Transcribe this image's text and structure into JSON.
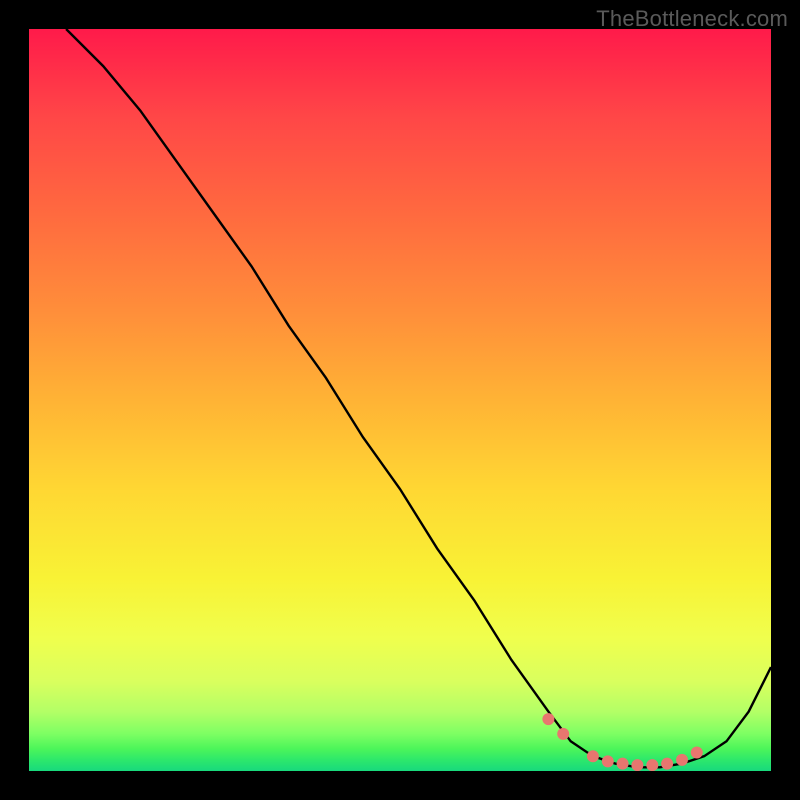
{
  "watermark": "TheBottleneck.com",
  "chart_data": {
    "type": "line",
    "title": "",
    "xlabel": "",
    "ylabel": "",
    "xlim": [
      0,
      100
    ],
    "ylim": [
      0,
      100
    ],
    "series": [
      {
        "name": "bottleneck-curve",
        "x": [
          5,
          10,
          15,
          20,
          25,
          30,
          35,
          40,
          45,
          50,
          55,
          60,
          65,
          70,
          73,
          76,
          79,
          82,
          85,
          88,
          91,
          94,
          97,
          100
        ],
        "y": [
          100,
          95,
          89,
          82,
          75,
          68,
          60,
          53,
          45,
          38,
          30,
          23,
          15,
          8,
          4,
          2,
          1,
          0.5,
          0.5,
          1,
          2,
          4,
          8,
          14
        ]
      }
    ],
    "markers": {
      "name": "highlight-dots",
      "x": [
        70,
        72,
        76,
        78,
        80,
        82,
        84,
        86,
        88,
        90
      ],
      "y": [
        7,
        5,
        2,
        1.3,
        1,
        0.8,
        0.8,
        1,
        1.5,
        2.5
      ]
    },
    "background_gradient": {
      "top": "#ff1a4a",
      "upper_mid": "#ff8e3a",
      "mid": "#ffd733",
      "lower_mid": "#f0ff4d",
      "bottom": "#18d97d"
    }
  }
}
